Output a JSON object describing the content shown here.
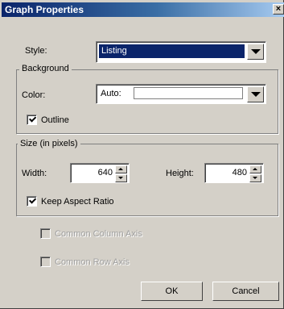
{
  "dialog": {
    "title": "Graph Properties",
    "close_glyph": "✕"
  },
  "style": {
    "label": "Style:",
    "value": "Listing"
  },
  "background": {
    "legend": "Background",
    "color_label": "Color:",
    "color_value": "Auto:",
    "outline_label": "Outline",
    "outline_checked": true
  },
  "size": {
    "legend": "Size (in pixels)",
    "width_label": "Width:",
    "width_value": "640",
    "height_label": "Height:",
    "height_value": "480",
    "keep_aspect_label": "Keep Aspect Ratio",
    "keep_aspect_checked": true
  },
  "axes": {
    "common_column_label": "Common Column Axis",
    "common_row_label": "Common Row Axis"
  },
  "buttons": {
    "ok": "OK",
    "cancel": "Cancel"
  },
  "colors": {
    "title_bar": "#0a246a",
    "face": "#d4d0c8",
    "selection": "#0a246a"
  }
}
